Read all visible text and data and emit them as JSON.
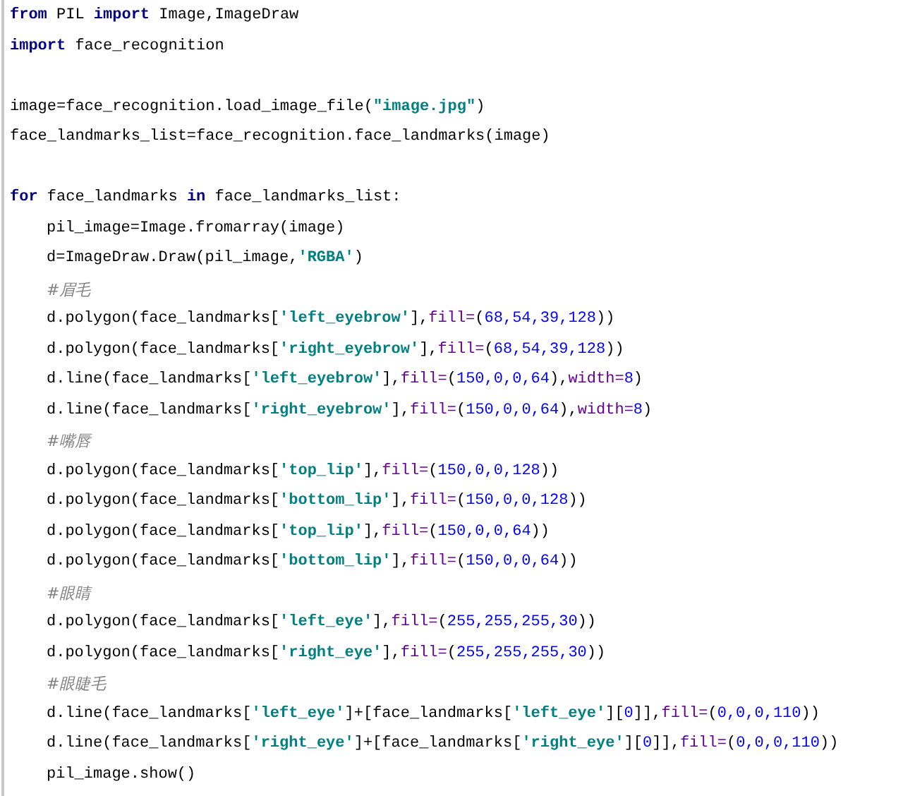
{
  "code_lines": [
    {
      "kind": "code",
      "tokens": [
        {
          "kind": "kw",
          "text": "from"
        },
        {
          "kind": "plain",
          "text": " PIL "
        },
        {
          "kind": "kw",
          "text": "import"
        },
        {
          "kind": "plain",
          "text": " Image,ImageDraw"
        }
      ]
    },
    {
      "kind": "code",
      "tokens": [
        {
          "kind": "kw",
          "text": "import"
        },
        {
          "kind": "plain",
          "text": " face_recognition"
        }
      ]
    },
    {
      "kind": "blank"
    },
    {
      "kind": "code",
      "tokens": [
        {
          "kind": "plain",
          "text": "image=face_recognition.load_image_file("
        },
        {
          "kind": "str",
          "text": "\"image.jpg\""
        },
        {
          "kind": "plain",
          "text": ")"
        }
      ]
    },
    {
      "kind": "code",
      "tokens": [
        {
          "kind": "plain",
          "text": "face_landmarks_list=face_recognition.face_landmarks(image)"
        }
      ]
    },
    {
      "kind": "blank"
    },
    {
      "kind": "code",
      "tokens": [
        {
          "kind": "kw",
          "text": "for"
        },
        {
          "kind": "plain",
          "text": " face_landmarks "
        },
        {
          "kind": "kw",
          "text": "in"
        },
        {
          "kind": "plain",
          "text": " face_landmarks_list:"
        }
      ],
      "children": [
        {
          "kind": "code",
          "tokens": [
            {
              "kind": "plain",
              "text": "pil_image=Image.fromarray(image)"
            }
          ]
        },
        {
          "kind": "code",
          "tokens": [
            {
              "kind": "plain",
              "text": "d=ImageDraw.Draw(pil_image,"
            },
            {
              "kind": "str",
              "text": "'RGBA'"
            },
            {
              "kind": "plain",
              "text": ")"
            }
          ]
        },
        {
          "kind": "code",
          "tokens": [
            {
              "kind": "cmt",
              "text": "#眉毛"
            }
          ]
        },
        {
          "kind": "code",
          "tokens": [
            {
              "kind": "plain",
              "text": "d.polygon(face_landmarks["
            },
            {
              "kind": "str",
              "text": "'left_eyebrow'"
            },
            {
              "kind": "plain",
              "text": "],"
            },
            {
              "kind": "kwarg",
              "text": "fill="
            },
            {
              "kind": "plain",
              "text": "("
            },
            {
              "kind": "num",
              "text": "68,54,39,128"
            },
            {
              "kind": "plain",
              "text": "))"
            }
          ]
        },
        {
          "kind": "code",
          "tokens": [
            {
              "kind": "plain",
              "text": "d.polygon(face_landmarks["
            },
            {
              "kind": "str",
              "text": "'right_eyebrow'"
            },
            {
              "kind": "plain",
              "text": "],"
            },
            {
              "kind": "kwarg",
              "text": "fill="
            },
            {
              "kind": "plain",
              "text": "("
            },
            {
              "kind": "num",
              "text": "68,54,39,128"
            },
            {
              "kind": "plain",
              "text": "))"
            }
          ]
        },
        {
          "kind": "code",
          "tokens": [
            {
              "kind": "plain",
              "text": "d.line(face_landmarks["
            },
            {
              "kind": "str",
              "text": "'left_eyebrow'"
            },
            {
              "kind": "plain",
              "text": "],"
            },
            {
              "kind": "kwarg",
              "text": "fill="
            },
            {
              "kind": "plain",
              "text": "("
            },
            {
              "kind": "num",
              "text": "150,0,0,64"
            },
            {
              "kind": "plain",
              "text": "),"
            },
            {
              "kind": "kwarg",
              "text": "width="
            },
            {
              "kind": "num",
              "text": "8"
            },
            {
              "kind": "plain",
              "text": ")"
            }
          ]
        },
        {
          "kind": "code",
          "tokens": [
            {
              "kind": "plain",
              "text": "d.line(face_landmarks["
            },
            {
              "kind": "str",
              "text": "'right_eyebrow'"
            },
            {
              "kind": "plain",
              "text": "],"
            },
            {
              "kind": "kwarg",
              "text": "fill="
            },
            {
              "kind": "plain",
              "text": "("
            },
            {
              "kind": "num",
              "text": "150,0,0,64"
            },
            {
              "kind": "plain",
              "text": "),"
            },
            {
              "kind": "kwarg",
              "text": "width="
            },
            {
              "kind": "num",
              "text": "8"
            },
            {
              "kind": "plain",
              "text": ")"
            }
          ]
        },
        {
          "kind": "code",
          "tokens": [
            {
              "kind": "cmt",
              "text": "#嘴唇"
            }
          ]
        },
        {
          "kind": "code",
          "tokens": [
            {
              "kind": "plain",
              "text": "d.polygon(face_landmarks["
            },
            {
              "kind": "str",
              "text": "'top_lip'"
            },
            {
              "kind": "plain",
              "text": "],"
            },
            {
              "kind": "kwarg",
              "text": "fill="
            },
            {
              "kind": "plain",
              "text": "("
            },
            {
              "kind": "num",
              "text": "150,0,0,128"
            },
            {
              "kind": "plain",
              "text": "))"
            }
          ]
        },
        {
          "kind": "code",
          "tokens": [
            {
              "kind": "plain",
              "text": "d.polygon(face_landmarks["
            },
            {
              "kind": "str",
              "text": "'bottom_lip'"
            },
            {
              "kind": "plain",
              "text": "],"
            },
            {
              "kind": "kwarg",
              "text": "fill="
            },
            {
              "kind": "plain",
              "text": "("
            },
            {
              "kind": "num",
              "text": "150,0,0,128"
            },
            {
              "kind": "plain",
              "text": "))"
            }
          ]
        },
        {
          "kind": "code",
          "tokens": [
            {
              "kind": "plain",
              "text": "d.polygon(face_landmarks["
            },
            {
              "kind": "str",
              "text": "'top_lip'"
            },
            {
              "kind": "plain",
              "text": "],"
            },
            {
              "kind": "kwarg",
              "text": "fill="
            },
            {
              "kind": "plain",
              "text": "("
            },
            {
              "kind": "num",
              "text": "150,0,0,64"
            },
            {
              "kind": "plain",
              "text": "))"
            }
          ]
        },
        {
          "kind": "code",
          "tokens": [
            {
              "kind": "plain",
              "text": "d.polygon(face_landmarks["
            },
            {
              "kind": "str",
              "text": "'bottom_lip'"
            },
            {
              "kind": "plain",
              "text": "],"
            },
            {
              "kind": "kwarg",
              "text": "fill="
            },
            {
              "kind": "plain",
              "text": "("
            },
            {
              "kind": "num",
              "text": "150,0,0,64"
            },
            {
              "kind": "plain",
              "text": "))"
            }
          ]
        },
        {
          "kind": "code",
          "tokens": [
            {
              "kind": "cmt",
              "text": "#眼睛"
            }
          ]
        },
        {
          "kind": "code",
          "tokens": [
            {
              "kind": "plain",
              "text": "d.polygon(face_landmarks["
            },
            {
              "kind": "str",
              "text": "'left_eye'"
            },
            {
              "kind": "plain",
              "text": "],"
            },
            {
              "kind": "kwarg",
              "text": "fill="
            },
            {
              "kind": "plain",
              "text": "("
            },
            {
              "kind": "num",
              "text": "255,255,255,30"
            },
            {
              "kind": "plain",
              "text": "))"
            }
          ]
        },
        {
          "kind": "code",
          "tokens": [
            {
              "kind": "plain",
              "text": "d.polygon(face_landmarks["
            },
            {
              "kind": "str",
              "text": "'right_eye'"
            },
            {
              "kind": "plain",
              "text": "],"
            },
            {
              "kind": "kwarg",
              "text": "fill="
            },
            {
              "kind": "plain",
              "text": "("
            },
            {
              "kind": "num",
              "text": "255,255,255,30"
            },
            {
              "kind": "plain",
              "text": "))"
            }
          ]
        },
        {
          "kind": "code",
          "tokens": [
            {
              "kind": "cmt",
              "text": "#眼睫毛"
            }
          ]
        },
        {
          "kind": "code",
          "tokens": [
            {
              "kind": "plain",
              "text": "d.line(face_landmarks["
            },
            {
              "kind": "str",
              "text": "'left_eye'"
            },
            {
              "kind": "plain",
              "text": "]+[face_landmarks["
            },
            {
              "kind": "str",
              "text": "'left_eye'"
            },
            {
              "kind": "plain",
              "text": "]["
            },
            {
              "kind": "num",
              "text": "0"
            },
            {
              "kind": "plain",
              "text": "]],"
            },
            {
              "kind": "kwarg",
              "text": "fill="
            },
            {
              "kind": "plain",
              "text": "("
            },
            {
              "kind": "num",
              "text": "0,0,0,110"
            },
            {
              "kind": "plain",
              "text": "))"
            }
          ]
        },
        {
          "kind": "code",
          "tokens": [
            {
              "kind": "plain",
              "text": "d.line(face_landmarks["
            },
            {
              "kind": "str",
              "text": "'right_eye'"
            },
            {
              "kind": "plain",
              "text": "]+[face_landmarks["
            },
            {
              "kind": "str",
              "text": "'right_eye'"
            },
            {
              "kind": "plain",
              "text": "]["
            },
            {
              "kind": "num",
              "text": "0"
            },
            {
              "kind": "plain",
              "text": "]],"
            },
            {
              "kind": "kwarg",
              "text": "fill="
            },
            {
              "kind": "plain",
              "text": "("
            },
            {
              "kind": "num",
              "text": "0,0,0,110"
            },
            {
              "kind": "plain",
              "text": "))"
            }
          ]
        },
        {
          "kind": "code",
          "tokens": [
            {
              "kind": "plain",
              "text": "pil_image.show()"
            }
          ]
        }
      ]
    }
  ]
}
